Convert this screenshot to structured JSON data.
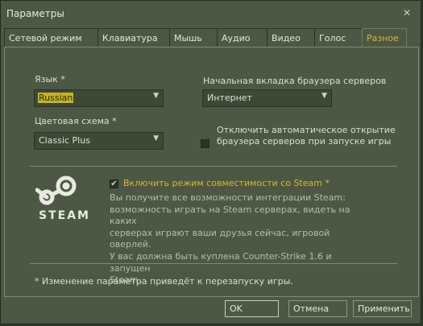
{
  "window": {
    "title": "Параметры",
    "close_glyph": "✕"
  },
  "tabs": [
    {
      "label": "Сетевой режим",
      "active": false
    },
    {
      "label": "Клавиатура",
      "active": false
    },
    {
      "label": "Мышь",
      "active": false
    },
    {
      "label": "Аудио",
      "active": false
    },
    {
      "label": "Видео",
      "active": false
    },
    {
      "label": "Голос",
      "active": false
    },
    {
      "label": "Разное",
      "active": true
    }
  ],
  "language": {
    "label": "Язык *",
    "value": "Russian"
  },
  "color_scheme": {
    "label": "Цветовая схема *",
    "value": "Classic Plus"
  },
  "browser_tab": {
    "label": "Начальная вкладка браузера серверов",
    "value": "Интернет"
  },
  "auto_open": {
    "line1": "Отключить автоматическое открытие",
    "line2": "браузера серверов при запуске игры",
    "checked": false
  },
  "steam": {
    "wordmark": "STEAM",
    "compat_label": "Включить режим совместимости со Steam *",
    "compat_checked": true,
    "description": [
      "Вы получите все возможности интеграции Steam:",
      "возможность играть на Steam серверах, видеть на каких",
      "серверах играют ваши друзья сейчас, игровой оверлей.",
      "У вас должна быть куплена Counter-Strike 1.6 и запущен",
      "Steam."
    ]
  },
  "footnote": "* Изменение параметра приведёт к перезапуску игры.",
  "buttons": {
    "ok": "OK",
    "cancel": "Отмена",
    "apply": "Применить"
  },
  "colors": {
    "background": "#4c5844",
    "accent": "#d9b43a",
    "selection": "#c4b42a"
  },
  "arrow_glyph": "▼",
  "check_glyph": "✔"
}
